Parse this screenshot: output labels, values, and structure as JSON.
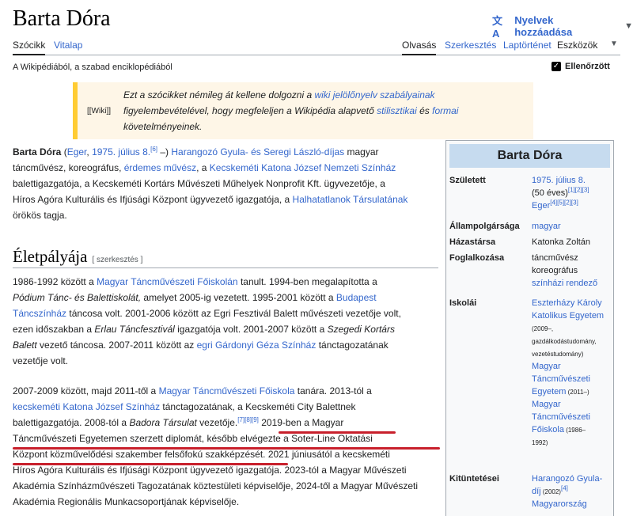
{
  "header": {
    "title": "Barta Dóra",
    "lang_button": "Nyelvek hozzáadása",
    "tabs_left": [
      "Szócikk",
      "Vitalap"
    ],
    "tabs_right": [
      "Olvasás",
      "Szerkesztés",
      "Laptörténet",
      "Eszközök"
    ],
    "tagline": "A Wikipédiából, a szabad enciklopédiából",
    "checked_label": "Ellenőrzött"
  },
  "notice": {
    "icon_text": "[[Wiki]]",
    "t1": "Ezt a szócikket némileg át kellene dolgozni a ",
    "l1": "wiki jelölőnyelv szabályainak",
    "t2": "figyelembevételével, hogy megfeleljen a Wikipédia alapvető ",
    "l2": "stilisztikai",
    "t3": " és ",
    "l3": "formai",
    "t4": "követelményeinek."
  },
  "intro": {
    "name": "Barta Dóra",
    "t1": " (",
    "l_eger": "Eger",
    "t2": ", ",
    "l_date": "1975. július 8.",
    "sup1": "[6]",
    "t3": " –) ",
    "l_award": "Harangozó Gyula- és Seregi László-díjas",
    "t4": " magyar",
    "t5": "táncművész, koreográfus, ",
    "l_erdemes": "érdemes művész",
    "t6": ", a ",
    "l_katona": "Kecskeméti Katona József Nemzeti Színház",
    "t7": "balettigazgatója, a Kecskeméti Kortárs Művészeti Műhelyek Nonprofit Kft. ügyvezetője, a",
    "t8": "Híros Agóra Kulturális és Ifjúsági Központ ügyvezető igazgatója, a ",
    "l_halh": "Halhatatlanok Társulatának",
    "t9": "örökös tagja."
  },
  "section": {
    "heading": "Életpályája",
    "edit": "[ szerkesztés ]"
  },
  "para1": {
    "a1": "1986-1992 között a ",
    "a_l": "Magyar Táncművészeti Főiskolán",
    "a2": " tanult. 1994-ben megalapította a",
    "b_i": "Pódium Tánc- és Balettiskolát,",
    "b2": " amelyet 2005-ig vezetett. 1995-2001 között a ",
    "b_l": "Budapest",
    "c_l": "Táncszínház",
    "c2": " táncosa volt. 2001-2006 között az Egri Fesztivál Balett művészeti vezetője volt,",
    "d1": "ezen időszakban a ",
    "d_i": "Erlau Táncfesztivál",
    "d2": " igazgatója volt. 2001-2007 között a ",
    "d_i2": "Szegedi Kortárs",
    "e_i": "Balett",
    "e2": " vezető táncosa. 2007-2011 között az ",
    "e_l": "egri Gárdonyi Géza Színház",
    "e3": " tánctagozatának",
    "f1": "vezetője volt."
  },
  "para2": {
    "a1": "2007-2009 között, majd 2011-től a ",
    "a_l": "Magyar Táncművészeti Főiskola",
    "a2": " tanára. 2013-tól a",
    "b_l": "kecskeméti Katona József Színház",
    "b2": " tánctagozatának, a Kecskeméti City Balettnek",
    "c1": "balettigazgatója. 2008-tól a ",
    "c_i": "Badora Társulat",
    "c2": " vezetője.",
    "c_sup": "[7][8][9]",
    "c3": " 2019-ben a Magyar",
    "d1": "Táncművészeti Egyetemen szerzett diplomát, később elvégezte a Soter-Line Oktatási",
    "e1": "Központ közművelődési szakember felsőfokú szakképzését. 2021 júniusától a kecskeméti",
    "f1": "Híros Agóra Kulturális és Ifjúsági Központ ügyvezető igazgatója. 2023-tól a Magyar Művészeti",
    "g1": "Akadémia Színházművészeti Tagozatának köztestületi képviselője, 2024-től a Magyar Művészeti",
    "h1": "Akadémia Regionális Munkacsoportjának képviselője."
  },
  "infobox": {
    "title": "Barta Dóra",
    "born_label": "Született",
    "born_date": "1975. július 8.",
    "born_age": "(50 éves)",
    "born_sup1": "[1][2][3]",
    "born_place": "Eger",
    "born_sup2": "[4][5][2][3]",
    "citizenship_label": "Állampolgársága",
    "citizenship": "magyar",
    "spouse_label": "Házastársa",
    "spouse": "Katonka Zoltán",
    "occupation_label": "Foglalkozása",
    "occ1": "táncművész",
    "occ2": "koreográfus",
    "occ3": "színházi rendező",
    "schools_label": "Iskolái",
    "school1a": "Eszterházy Károly",
    "school1b": "Katolikus Egyetem",
    "school1c": "(2009–,",
    "school1d": "gazdálkodástudomány,",
    "school1e": "vezetéstudomány)",
    "school2a": "Magyar",
    "school2b": "Táncművészeti",
    "school2c": "Egyetem",
    "school2d": " (2011–)",
    "school3a": "Magyar",
    "school3b": "Táncművészeti",
    "school3c": "Főiskola",
    "school3d": " (1986–",
    "school3e": "1992)",
    "awards_label": "Kitüntetései",
    "award1a": "Harangozó Gyula-",
    "award1b": "díj",
    "award1c": " (2002)",
    "award1sup": "[4]",
    "award2": "Magyarország"
  }
}
